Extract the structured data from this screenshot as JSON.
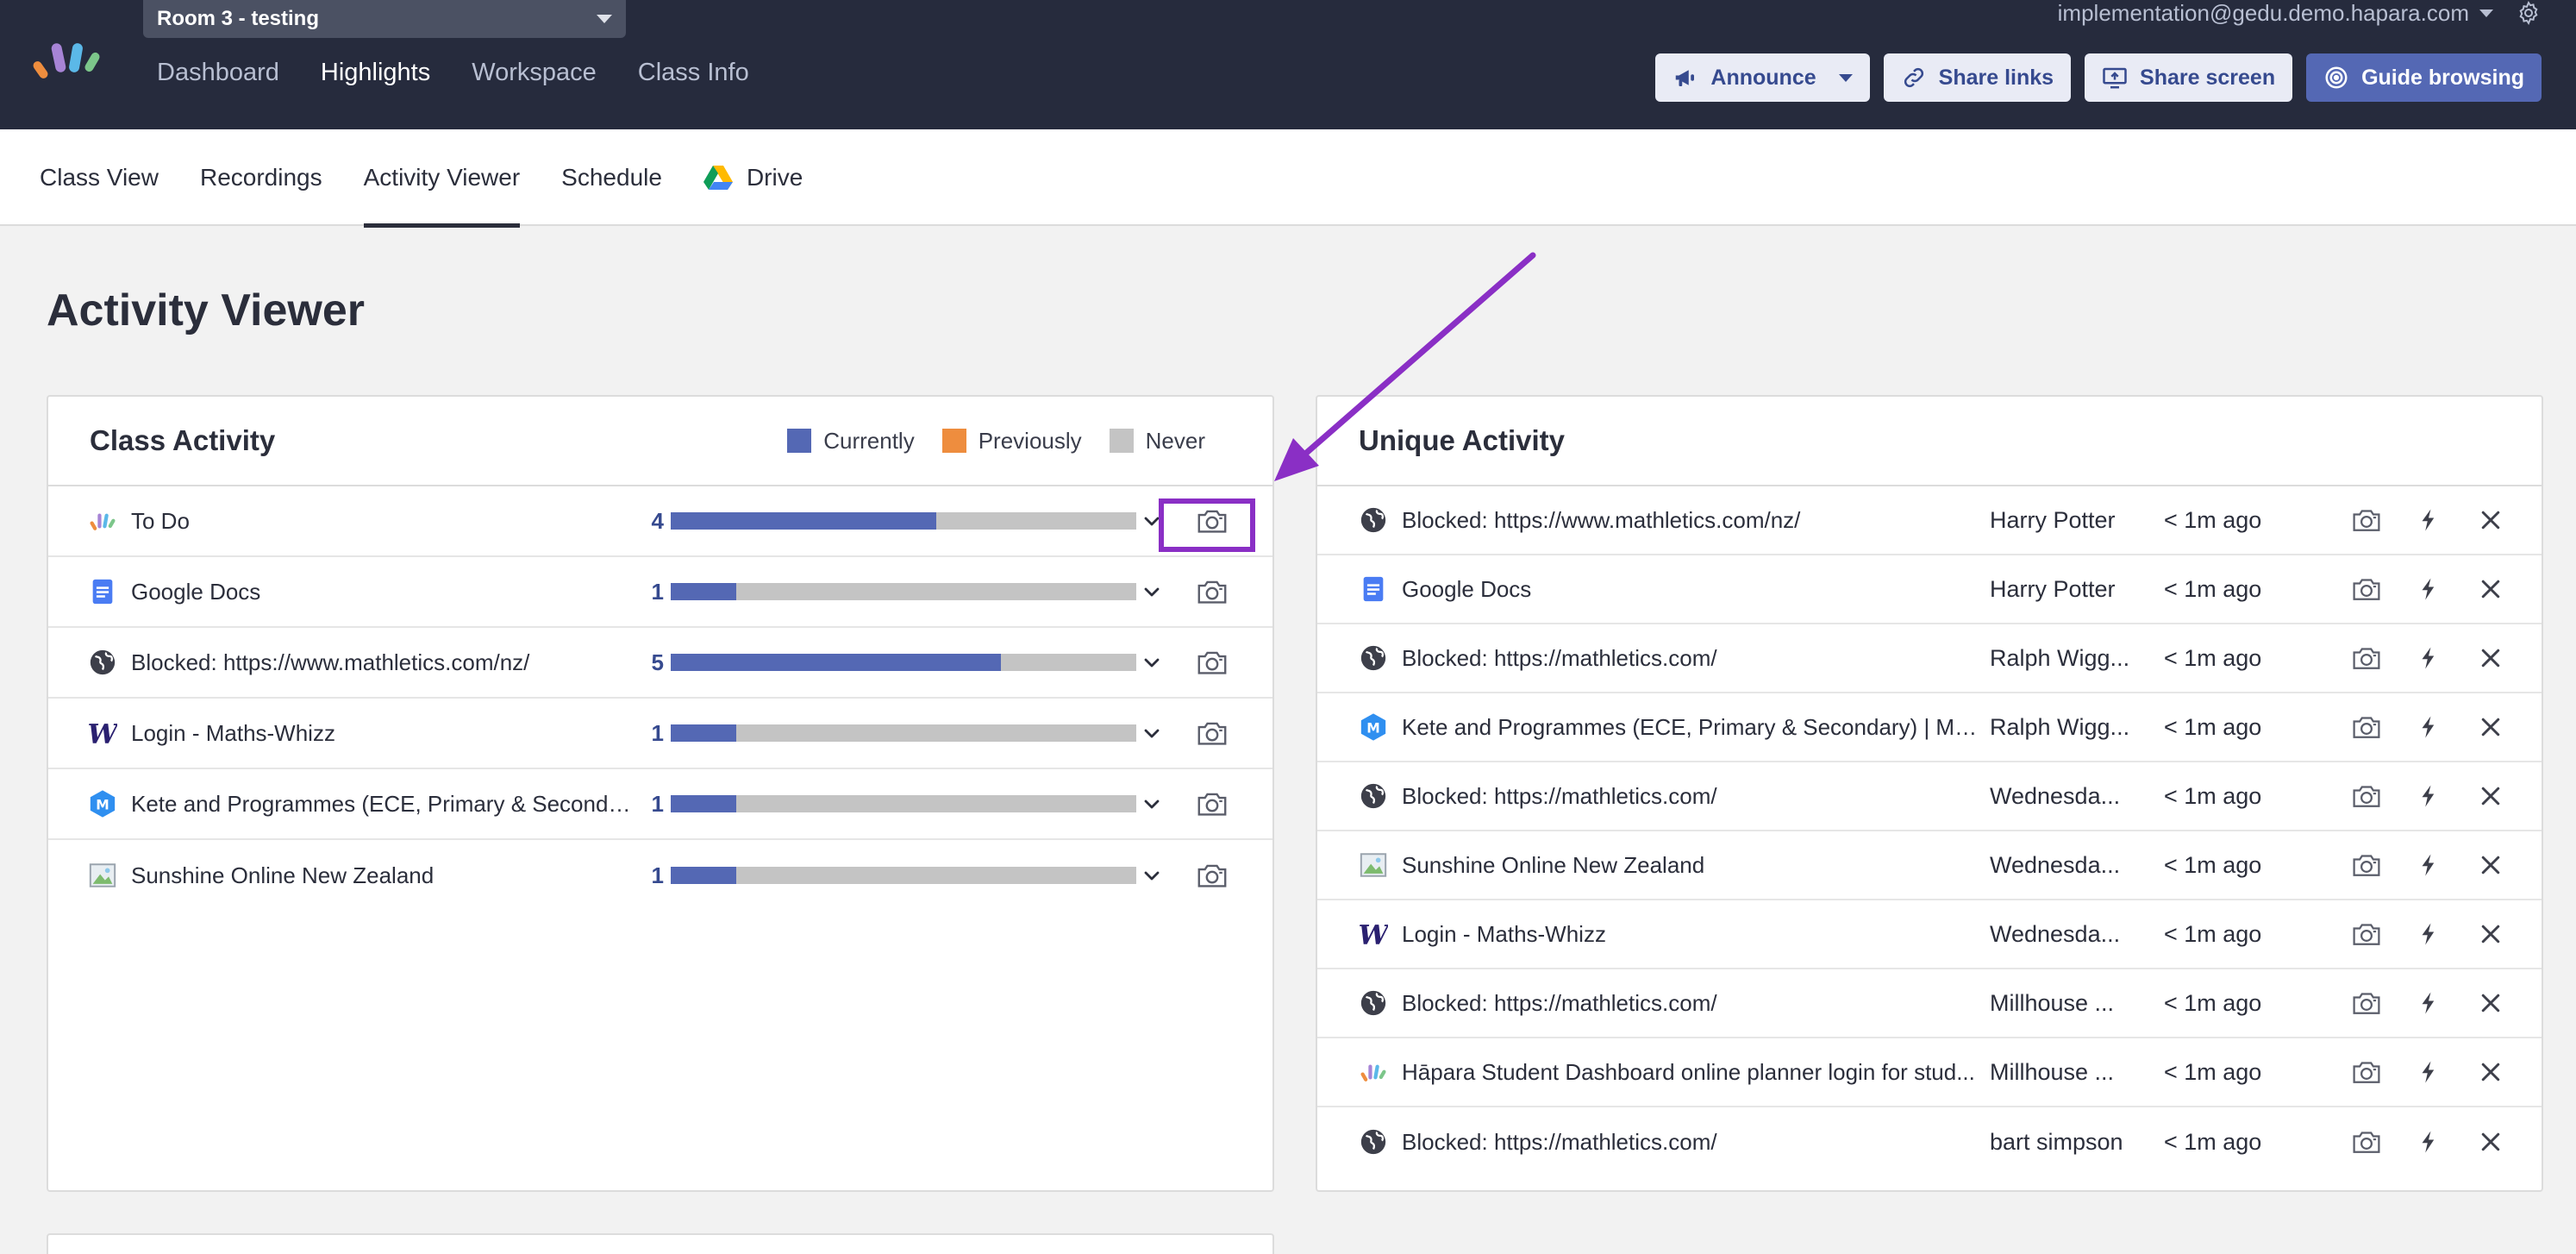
{
  "header": {
    "room_select": "Room 3 - testing",
    "nav": [
      {
        "label": "Dashboard",
        "active": false
      },
      {
        "label": "Highlights",
        "active": true
      },
      {
        "label": "Workspace",
        "active": false
      },
      {
        "label": "Class Info",
        "active": false
      }
    ],
    "user_email": "implementation@gedu.demo.hapara.com",
    "buttons": {
      "announce": "Announce",
      "share_links": "Share links",
      "share_screen": "Share screen",
      "guide_browsing": "Guide browsing"
    }
  },
  "subnav": [
    {
      "label": "Class View",
      "active": false
    },
    {
      "label": "Recordings",
      "active": false
    },
    {
      "label": "Activity Viewer",
      "active": true
    },
    {
      "label": "Schedule",
      "active": false
    },
    {
      "label": "Drive",
      "active": false,
      "icon": "google-drive-icon"
    }
  ],
  "page_title": "Activity Viewer",
  "class_activity": {
    "title": "Class Activity",
    "legend": [
      {
        "label": "Currently",
        "color": "#5468b4"
      },
      {
        "label": "Previously",
        "color": "#ee8d3e"
      },
      {
        "label": "Never",
        "color": "#c4c4c4"
      }
    ],
    "rows": [
      {
        "icon": "hapara-logo-icon",
        "label": "To Do",
        "count": "4",
        "current_fraction": 0.57
      },
      {
        "icon": "google-docs-icon",
        "label": "Google Docs",
        "count": "1",
        "current_fraction": 0.14
      },
      {
        "icon": "globe-icon",
        "label": "Blocked: https://www.mathletics.com/nz/",
        "count": "5",
        "current_fraction": 0.71
      },
      {
        "icon": "maths-whizz-icon",
        "label": "Login - Maths-Whizz",
        "count": "1",
        "current_fraction": 0.14
      },
      {
        "icon": "m-badge-icon",
        "label": "Kete and Programmes (ECE, Primary & Secondary...",
        "count": "1",
        "current_fraction": 0.14
      },
      {
        "icon": "image-icon",
        "label": "Sunshine Online New Zealand",
        "count": "1",
        "current_fraction": 0.14
      }
    ]
  },
  "unique_activity": {
    "title": "Unique Activity",
    "rows": [
      {
        "icon": "globe-icon",
        "label": "Blocked: https://www.mathletics.com/nz/",
        "student": "Harry Potter",
        "time": "< 1m ago"
      },
      {
        "icon": "google-docs-icon",
        "label": "Google Docs",
        "student": "Harry Potter",
        "time": "< 1m ago"
      },
      {
        "icon": "globe-icon",
        "label": "Blocked: https://mathletics.com/",
        "student": "Ralph Wigg...",
        "time": "< 1m ago"
      },
      {
        "icon": "m-badge-icon",
        "label": "Kete and Programmes (ECE, Primary & Secondary) | MO...",
        "student": "Ralph Wigg...",
        "time": "< 1m ago"
      },
      {
        "icon": "globe-icon",
        "label": "Blocked: https://mathletics.com/",
        "student": "Wednesda...",
        "time": "< 1m ago"
      },
      {
        "icon": "image-icon",
        "label": "Sunshine Online New Zealand",
        "student": "Wednesda...",
        "time": "< 1m ago"
      },
      {
        "icon": "maths-whizz-icon",
        "label": "Login - Maths-Whizz",
        "student": "Wednesda...",
        "time": "< 1m ago"
      },
      {
        "icon": "globe-icon",
        "label": "Blocked: https://mathletics.com/",
        "student": "Millhouse ...",
        "time": "< 1m ago"
      },
      {
        "icon": "hapara-logo-icon",
        "label": "Hāpara Student Dashboard online planner login for stud...",
        "student": "Millhouse ...",
        "time": "< 1m ago"
      },
      {
        "icon": "globe-icon",
        "label": "Blocked: https://mathletics.com/",
        "student": "bart simpson",
        "time": "< 1m ago"
      }
    ]
  },
  "annotation": {
    "color": "#8a2fc5"
  }
}
